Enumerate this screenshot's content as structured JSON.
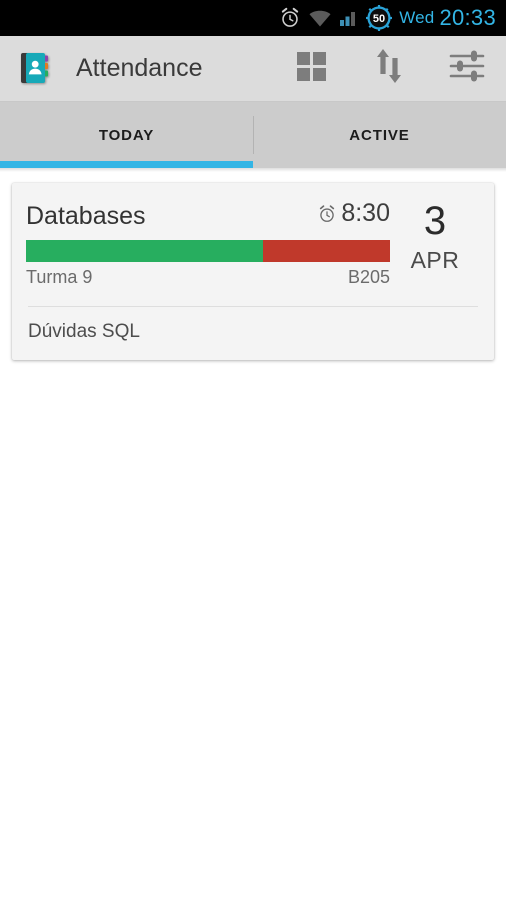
{
  "status_bar": {
    "icons": [
      "alarm-icon",
      "wifi-icon",
      "signal-icon",
      "battery-icon"
    ],
    "battery_level": "50",
    "day": "Wed",
    "time": "20:33",
    "accent_color": "#33b5e5",
    "background_color": "#000000"
  },
  "action_bar": {
    "app_icon": "attendance-book-icon",
    "title": "Attendance",
    "background_color": "#dcdcdc",
    "actions": [
      {
        "name": "grid-view-icon",
        "label": "Grid view"
      },
      {
        "name": "sort-arrows-icon",
        "label": "Sort"
      },
      {
        "name": "filter-sliders-icon",
        "label": "Filter"
      }
    ]
  },
  "tabs": {
    "selected_index": 0,
    "indicator_color": "#33b5e5",
    "items": [
      {
        "label": "TODAY"
      },
      {
        "label": "ACTIVE"
      }
    ]
  },
  "card": {
    "course": "Databases",
    "clock_icon": "alarm-clock-icon",
    "time": "8:30",
    "progress": {
      "done_percent": 65,
      "remaining_percent": 35,
      "done_color": "#27ae5f",
      "remaining_color": "#c0392b"
    },
    "class_group": "Turma 9",
    "room": "B205",
    "date_day": "3",
    "date_month": "APR",
    "note": "Dúvidas SQL"
  }
}
